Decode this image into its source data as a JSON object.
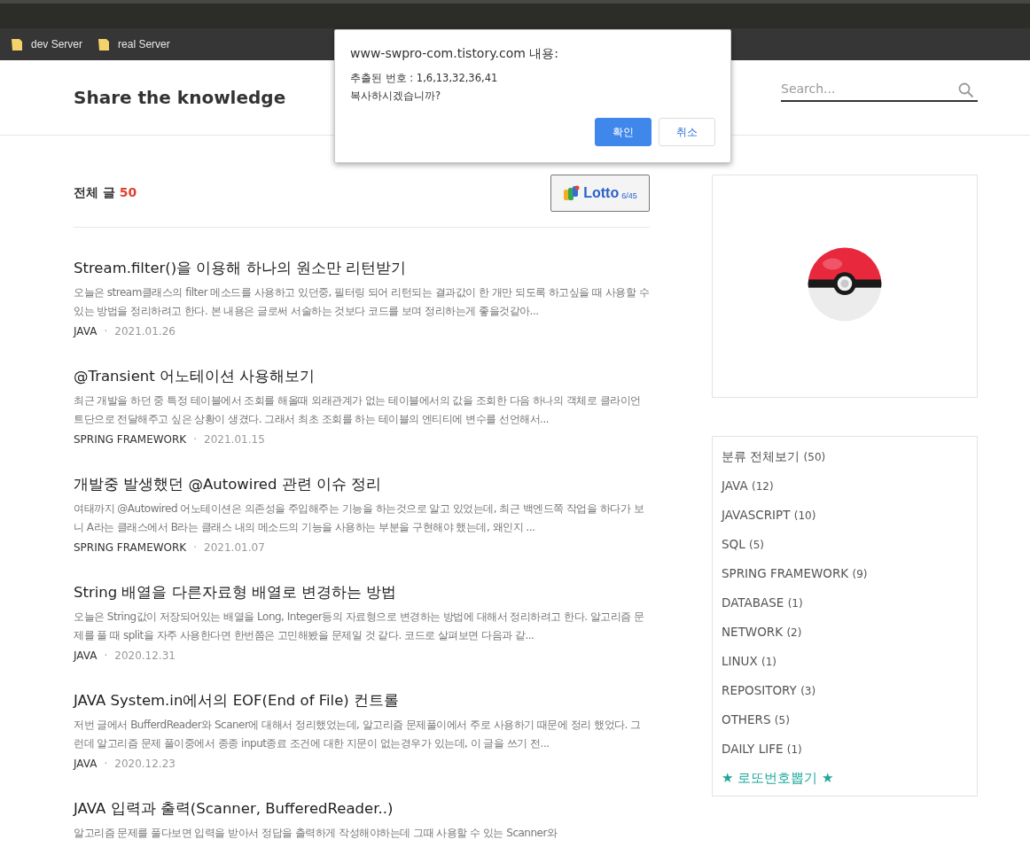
{
  "bookmarks": [
    {
      "label": "dev Server"
    },
    {
      "label": "real Server"
    }
  ],
  "blog": {
    "title": "Share the knowledge",
    "search": {
      "placeholder": "Search..."
    }
  },
  "post_list": {
    "label": "전체 글",
    "count": "50",
    "lotto_button": {
      "label": "Lotto",
      "sub": "6/45"
    }
  },
  "posts": [
    {
      "title": "Stream.filter()을 이용해 하나의 원소만 리턴받기",
      "excerpt": "오늘은 stream클래스의 filter 메소드를 사용하고 있던중, 필터링 되어 리턴되는 결과값이 한 개만 되도록 하고싶을 때 사용할 수 있는 방법을 정리하려고 한다. 본 내용은 글로써 서술하는 것보다 코드를 보며 정리하는게 좋을것같아...",
      "category": "JAVA",
      "separator": "·",
      "date": "2021.01.26"
    },
    {
      "title": "@Transient 어노테이션 사용해보기",
      "excerpt": "최근 개발을 하던 중 특정 테이블에서 조회를 해올때 외래관계가 없는 테이블에서의 값을 조회한 다음 하나의 객체로 클라이언트단으로 전달해주고 싶은 상황이 생겼다. 그래서 최초 조회를 하는 테이블의 엔티티에 변수를 선언해서...",
      "category": "SPRING FRAMEWORK",
      "separator": "·",
      "date": "2021.01.15"
    },
    {
      "title": "개발중 발생했던 @Autowired 관련 이슈 정리",
      "excerpt": "여태까지 @Autowired 어노테이션은 의존성을 주입해주는 기능을 하는것으로 알고 있었는데, 최근 백엔드쪽 작업을 하다가 보니 A라는 클래스에서 B라는 클래스 내의 메소드의 기능을 사용하는 부분을 구현해야 했는데, 왜인지 ...",
      "category": "SPRING FRAMEWORK",
      "separator": "·",
      "date": "2021.01.07"
    },
    {
      "title": "String 배열을 다른자료형 배열로 변경하는 방법",
      "excerpt": "오늘은 String값이 저장되어있는 배열을 Long, Integer등의 자료형으로 변경하는 방법에 대해서 정리하려고 한다. 알고리즘 문제를 풀 때 split을 자주 사용한다면 한번쯤은 고민해봤을 문제일 것 같다. 코드로 살펴보면 다음과 같...",
      "category": "JAVA",
      "separator": "·",
      "date": "2020.12.31"
    },
    {
      "title": "JAVA System.in에서의 EOF(End of File) 컨트롤",
      "excerpt": "저번 글에서 BufferdReader와 Scaner에 대해서 정리했었는데, 알고리즘 문제풀이에서 주로 사용하기 때문에 정리 했었다. 그런데 알고리즘 문제 풀이중에서 종종 input종료 조건에 대한 지문이 없는경우가 있는데, 이 글을 쓰기 전...",
      "category": "JAVA",
      "separator": "·",
      "date": "2020.12.23"
    },
    {
      "title": "JAVA 입력과 출력(Scanner, BufferedReader..)",
      "excerpt": "알고리즘 문제를 풀다보면 입력을 받아서 정답을 출력하게 작성해야하는데 그때 사용할 수 있는 Scanner와"
    }
  ],
  "categories": [
    {
      "name": "분류 전체보기",
      "count": "(50)",
      "kind": "category"
    },
    {
      "name": "JAVA",
      "count": "(12)",
      "kind": "category"
    },
    {
      "name": "JAVASCRIPT",
      "count": "(10)",
      "kind": "category"
    },
    {
      "name": "SQL",
      "count": "(5)",
      "kind": "category"
    },
    {
      "name": "SPRING FRAMEWORK",
      "count": "(9)",
      "kind": "category"
    },
    {
      "name": "DATABASE",
      "count": "(1)",
      "kind": "category"
    },
    {
      "name": "NETWORK",
      "count": "(2)",
      "kind": "category"
    },
    {
      "name": "LINUX",
      "count": "(1)",
      "kind": "category"
    },
    {
      "name": "REPOSITORY",
      "count": "(3)",
      "kind": "category"
    },
    {
      "name": "OTHERS",
      "count": "(5)",
      "kind": "category"
    },
    {
      "name": "DAILY LIFE",
      "count": "(1)",
      "kind": "category"
    },
    {
      "name": "★ 로또번호뽑기 ★",
      "kind": "link"
    }
  ],
  "dialog": {
    "title": "www-swpro-com.tistory.com 내용:",
    "lines": [
      "추출된 번호 : 1,6,13,32,36,41",
      "복사하시겠습니까?"
    ],
    "buttons": [
      {
        "label": "확인",
        "primary": true
      },
      {
        "label": "취소",
        "primary": false
      }
    ]
  }
}
